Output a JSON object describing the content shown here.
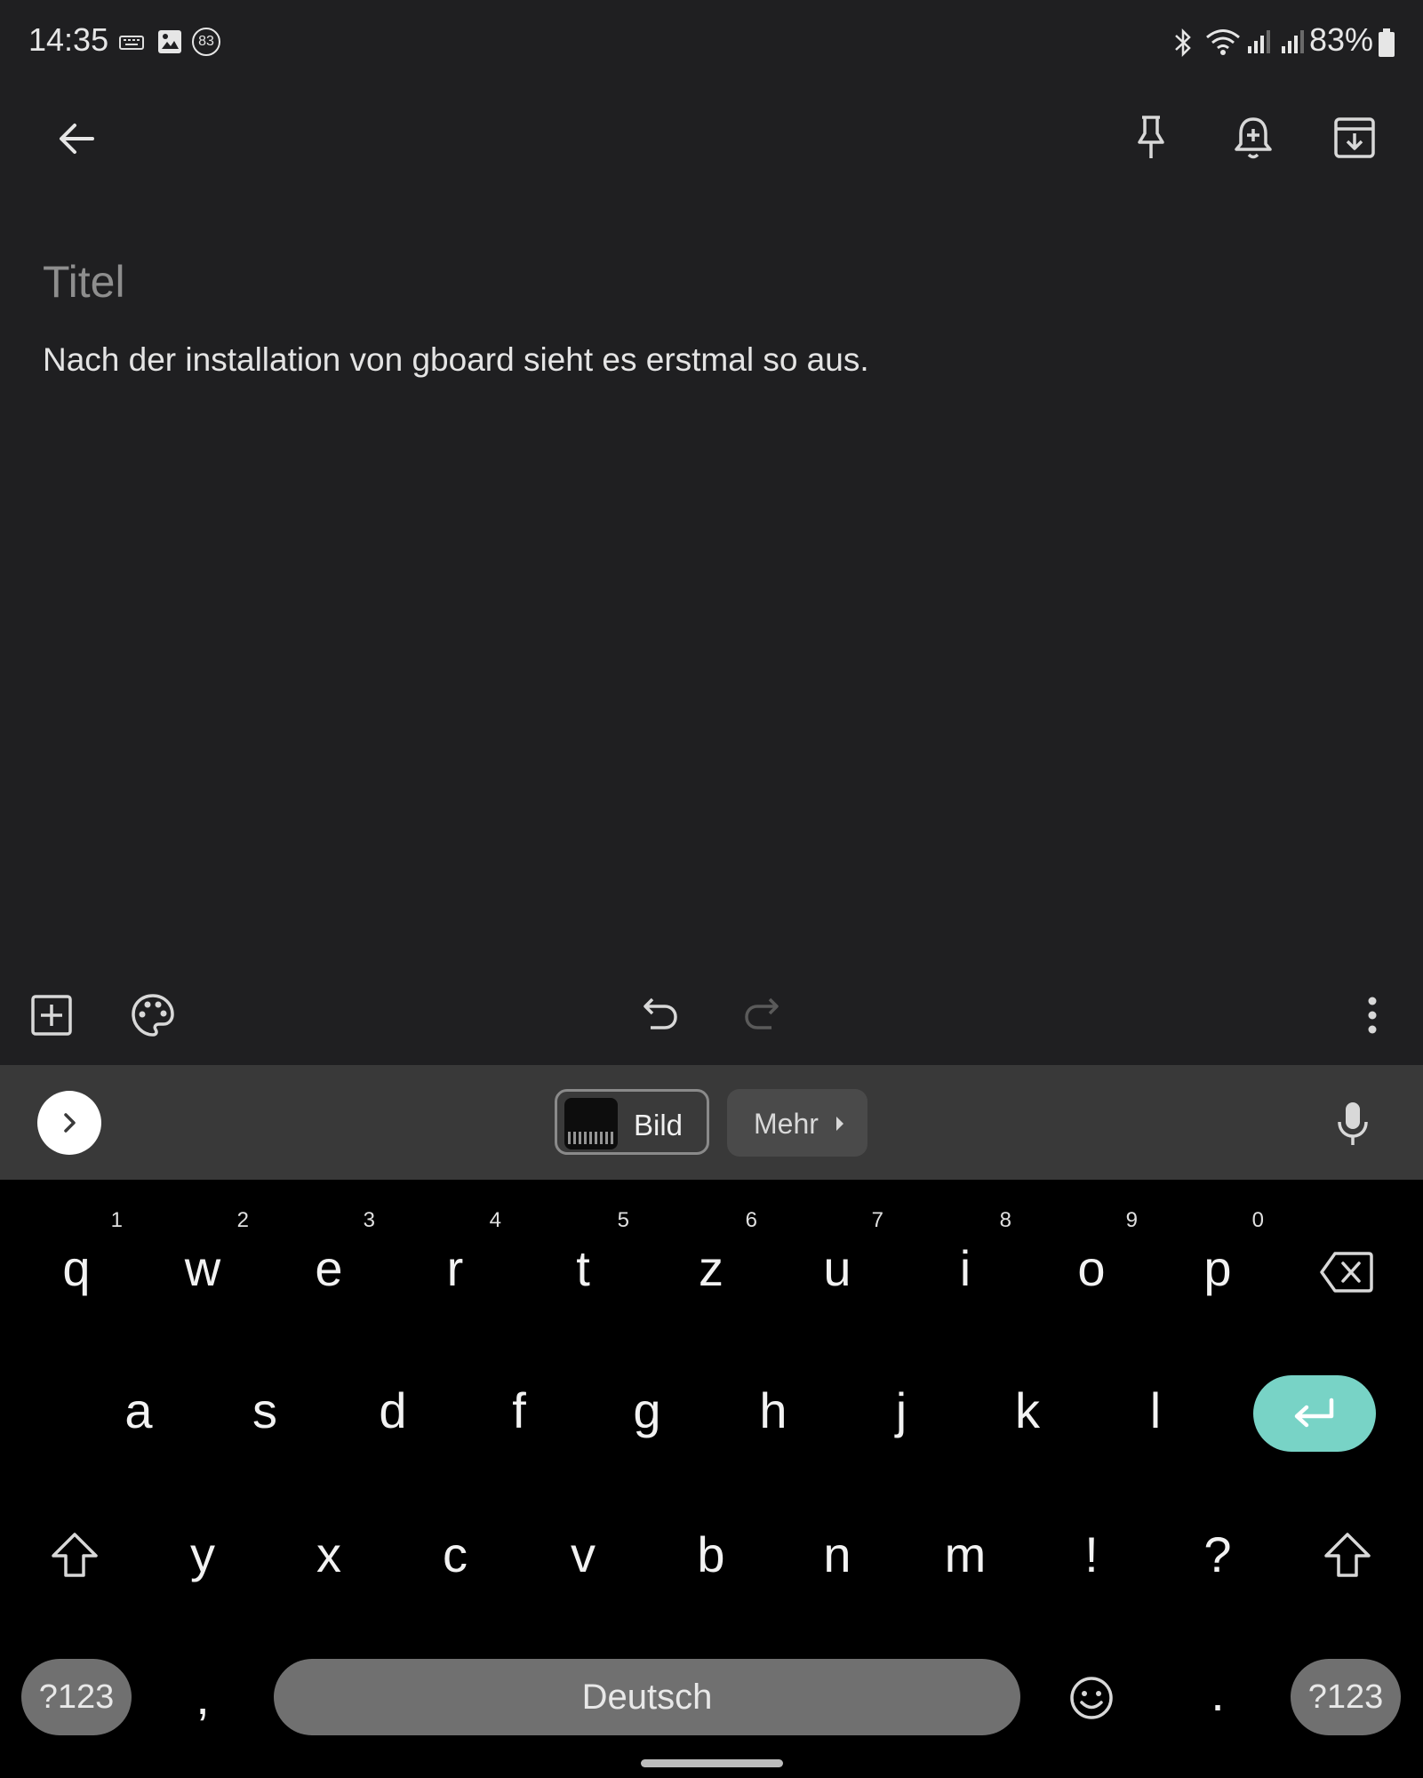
{
  "status_bar": {
    "time": "14:35",
    "notification_badge": "83",
    "battery": "83%"
  },
  "note": {
    "title_placeholder": "Titel",
    "body_text": "Nach der installation von gboard sieht es erstmal so aus."
  },
  "keyboard_toolbar": {
    "chip_bild": "Bild",
    "chip_mehr": "Mehr"
  },
  "keyboard": {
    "row1": [
      {
        "key": "q",
        "hint": "1"
      },
      {
        "key": "w",
        "hint": "2"
      },
      {
        "key": "e",
        "hint": "3"
      },
      {
        "key": "r",
        "hint": "4"
      },
      {
        "key": "t",
        "hint": "5"
      },
      {
        "key": "z",
        "hint": "6"
      },
      {
        "key": "u",
        "hint": "7"
      },
      {
        "key": "i",
        "hint": "8"
      },
      {
        "key": "o",
        "hint": "9"
      },
      {
        "key": "p",
        "hint": "0"
      }
    ],
    "row2": [
      "a",
      "s",
      "d",
      "f",
      "g",
      "h",
      "j",
      "k",
      "l"
    ],
    "row3": [
      "y",
      "x",
      "c",
      "v",
      "b",
      "n",
      "m",
      "!",
      "?"
    ],
    "symbols_label": "?123",
    "comma": ",",
    "space_label": "Deutsch",
    "period": "."
  },
  "colors": {
    "background": "#1f1f21",
    "keyboard_bg": "#000000",
    "toolbar_bg": "#393939",
    "enter_accent": "#78d3c6"
  }
}
